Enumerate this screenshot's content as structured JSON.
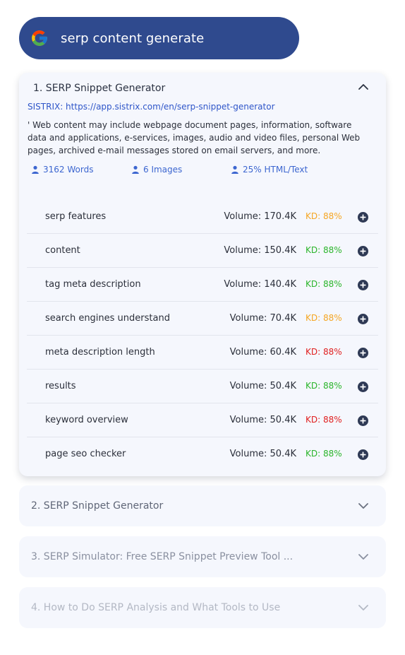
{
  "search": {
    "query": "serp content generate",
    "icon": "google-icon"
  },
  "colors": {
    "searchbar": "#2f4a8e",
    "link": "#2f56c9",
    "kd_orange": "#f5a623",
    "kd_green": "#2bb52b",
    "kd_red": "#e02020",
    "plus": "#2f3a55"
  },
  "results": [
    {
      "title": "1. SERP Snippet Generator",
      "source": "SISTRIX: https://app.sistrix.com/en/serp-snippet-generator",
      "description": "' Web content may include webpage document pages, information, software data and applications, e-services, images, audio and video files, personal Web pages, archived e-mail messages stored on email servers, and more.",
      "stats": {
        "words": "3162 Words",
        "images": "6 Images",
        "html_ratio": "25% HTML/Text"
      },
      "keywords": [
        {
          "keyword": "serp features",
          "volume": "Volume: 170.4K",
          "kd": "KD: 88%",
          "kd_color": "#f5a623"
        },
        {
          "keyword": "content",
          "volume": "Volume: 150.4K",
          "kd": "KD: 88%",
          "kd_color": "#2bb52b"
        },
        {
          "keyword": "tag meta description",
          "volume": "Volume: 140.4K",
          "kd": "KD: 88%",
          "kd_color": "#2bb52b"
        },
        {
          "keyword": "search engines understand",
          "volume": "Volume: 70.4K",
          "kd": "KD: 88%",
          "kd_color": "#f5a623"
        },
        {
          "keyword": "meta description length",
          "volume": "Volume: 60.4K",
          "kd": "KD: 88%",
          "kd_color": "#e02020"
        },
        {
          "keyword": "results",
          "volume": "Volume: 50.4K",
          "kd": "KD: 88%",
          "kd_color": "#2bb52b"
        },
        {
          "keyword": "keyword overview",
          "volume": "Volume: 50.4K",
          "kd": "KD: 88%",
          "kd_color": "#e02020"
        },
        {
          "keyword": "page seo checker",
          "volume": "Volume: 50.4K",
          "kd": "KD: 88%",
          "kd_color": "#2bb52b"
        }
      ]
    },
    {
      "title": "2. SERP Snippet Generator"
    },
    {
      "title": "3. SERP Simulator: Free SERP Snippet Preview Tool ..."
    },
    {
      "title": "4. How to Do SERP Analysis and What Tools to Use"
    }
  ]
}
